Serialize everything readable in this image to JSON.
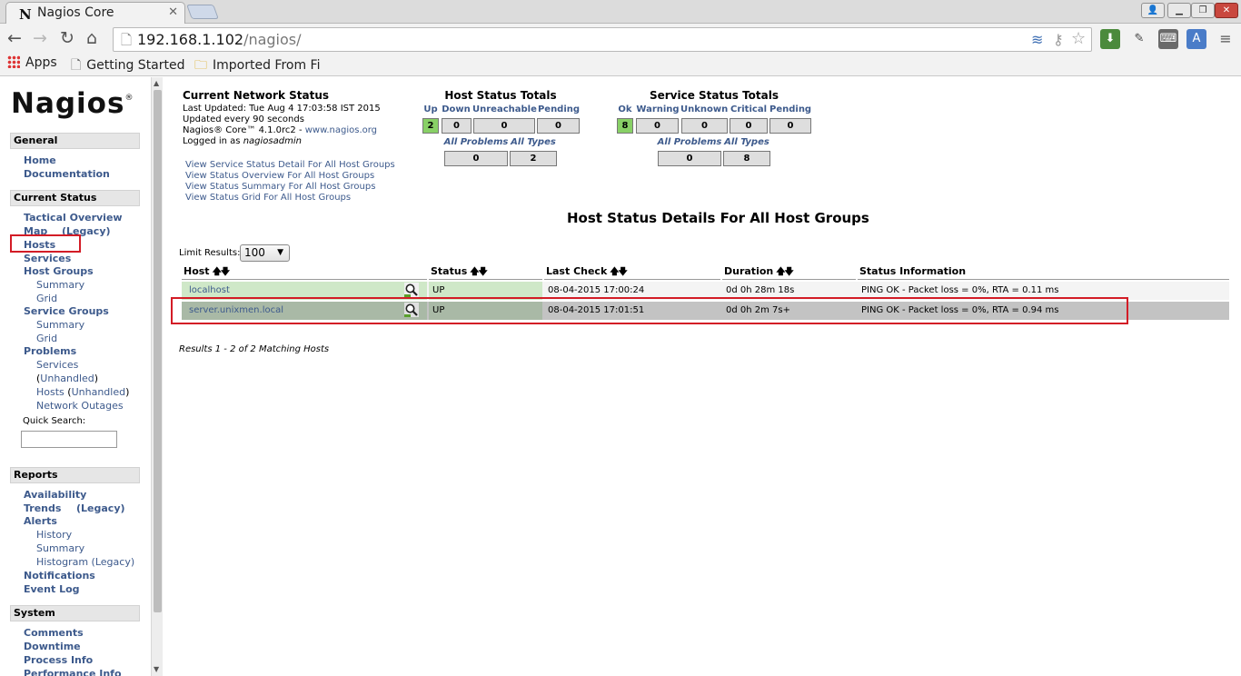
{
  "browser": {
    "tab_title": "Nagios Core",
    "tab_favicon": "N",
    "url_host": "192.168.1.102",
    "url_path": "/nagios/",
    "bookmarks": [
      "Apps",
      "Getting Started",
      "Imported From Fi"
    ]
  },
  "sidebar": {
    "logo": "Nagios",
    "logo_mark": "®",
    "sections": {
      "general": "General",
      "current_status": "Current Status",
      "reports": "Reports",
      "system": "System"
    },
    "general": {
      "home": "Home",
      "documentation": "Documentation"
    },
    "current_status": {
      "tactical_overview": "Tactical Overview",
      "map": "Map",
      "map_legacy": "(Legacy)",
      "hosts": "Hosts",
      "services": "Services",
      "host_groups": "Host Groups",
      "hg_summary": "Summary",
      "hg_grid": "Grid",
      "service_groups": "Service Groups",
      "sg_summary": "Summary",
      "sg_grid": "Grid",
      "problems": "Problems",
      "p_services": "Services",
      "p_unhandled_1": "Unhandled",
      "p_hosts": "Hosts",
      "p_unhandled_2": "Unhandled",
      "network_outages": "Network Outages"
    },
    "quick_search_label": "Quick Search:",
    "reports": {
      "availability": "Availability",
      "trends": "Trends",
      "trends_legacy": "(Legacy)",
      "alerts": "Alerts",
      "history": "History",
      "summary": "Summary",
      "histogram": "Histogram (Legacy)",
      "notifications": "Notifications",
      "event_log": "Event Log"
    },
    "system": {
      "comments": "Comments",
      "downtime": "Downtime",
      "process_info": "Process Info",
      "performance_info": "Performance Info"
    }
  },
  "network_status": {
    "title": "Current Network Status",
    "last_updated": "Last Updated: Tue Aug 4 17:03:58 IST 2015",
    "update_interval": "Updated every 90 seconds",
    "version_prefix": "Nagios® Core™ 4.1.0rc2 - ",
    "version_link": "www.nagios.org",
    "logged_in_prefix": "Logged in as ",
    "logged_in_user": "nagiosadmin",
    "view_links": [
      "View Service Status Detail For All Host Groups",
      "View Status Overview For All Host Groups",
      "View Status Summary For All Host Groups",
      "View Status Grid For All Host Groups"
    ]
  },
  "host_totals": {
    "title": "Host Status Totals",
    "headers": [
      "Up",
      "Down",
      "Unreachable",
      "Pending"
    ],
    "values": [
      "2",
      "0",
      "0",
      "0"
    ],
    "sub_headers": [
      "All Problems",
      "All Types"
    ],
    "sub_values": [
      "0",
      "2"
    ]
  },
  "service_totals": {
    "title": "Service Status Totals",
    "headers": [
      "Ok",
      "Warning",
      "Unknown",
      "Critical",
      "Pending"
    ],
    "values": [
      "8",
      "0",
      "0",
      "0",
      "0"
    ],
    "sub_headers": [
      "All Problems",
      "All Types"
    ],
    "sub_values": [
      "0",
      "8"
    ]
  },
  "host_table": {
    "title": "Host Status Details For All Host Groups",
    "limit_label": "Limit Results:",
    "limit_value": "100",
    "columns": [
      "Host",
      "Status",
      "Last Check",
      "Duration",
      "Status Information"
    ],
    "rows": [
      {
        "host": "localhost",
        "status": "UP",
        "last_check": "08-04-2015 17:00:24",
        "duration": "0d 0h 28m 18s",
        "info": "PING OK - Packet loss = 0%, RTA = 0.11 ms"
      },
      {
        "host": "server.unixmen.local",
        "status": "UP",
        "last_check": "08-04-2015 17:01:51",
        "duration": "0d 0h 2m 7s+",
        "info": "PING OK - Packet loss = 0%, RTA = 0.94 ms"
      }
    ],
    "results": "Results 1 - 2 of 2 Matching Hosts"
  },
  "colors": {
    "link": "#3d5a8c",
    "status_ok": "#88d066",
    "row_ok": "#cfe8c8",
    "highlight": "#d31c26"
  }
}
